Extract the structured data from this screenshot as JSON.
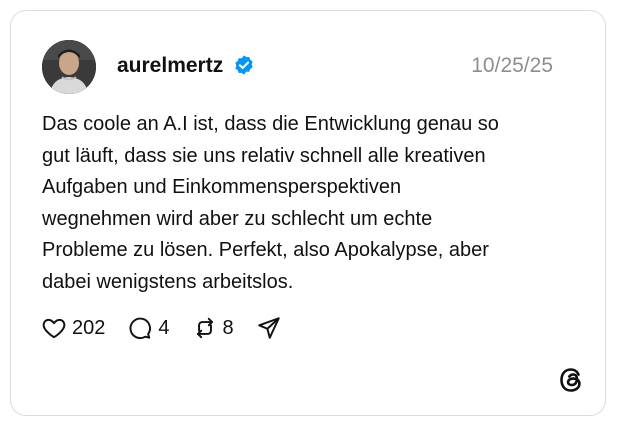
{
  "post": {
    "username": "aurelmertz",
    "date": "10/25/25",
    "text": "Das coole an A.I ist, dass die Entwicklung genau so\ngut läuft, dass sie uns relativ schnell alle kreativen\nAufgaben und Einkommensperspektiven\nwegnehmen wird aber zu schlecht um echte\nProbleme zu lösen. Perfekt, also Apokalypse, aber\ndabei wenigstens arbeitslos."
  },
  "actions": {
    "likes": "202",
    "replies": "4",
    "reposts": "8"
  },
  "icons": {
    "verified": "verified-badge-icon",
    "like": "heart-icon",
    "reply": "comment-icon",
    "repost": "repost-icon",
    "share": "send-icon",
    "brand": "threads-logo-icon"
  },
  "colors": {
    "verified": "#0095f6",
    "date": "#8e8e8e",
    "border": "#dcdcdc"
  }
}
